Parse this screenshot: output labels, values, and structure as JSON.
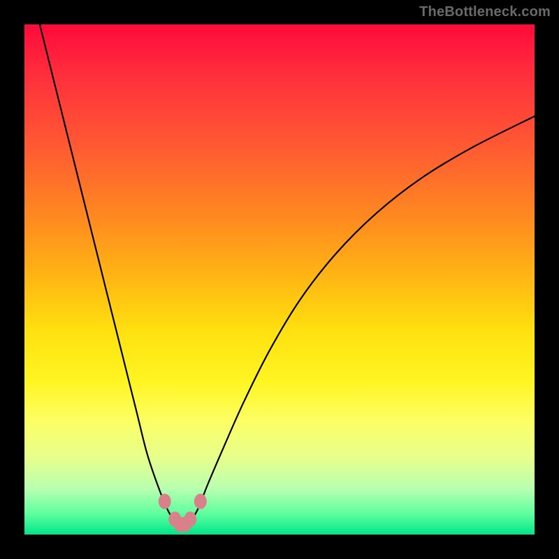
{
  "watermark": "TheBottleneck.com",
  "colors": {
    "frame": "#000000",
    "watermark_text": "#6a6a6a",
    "curve": "#000000",
    "marker": "#d9818a",
    "gradient_top": "#ff0a3a",
    "gradient_bottom": "#00e58a"
  },
  "chart_data": {
    "type": "line",
    "title": "",
    "xlabel": "",
    "ylabel": "",
    "xlim": [
      0,
      100
    ],
    "ylim": [
      0,
      100
    ],
    "grid": false,
    "legend": false,
    "x": [
      3,
      5,
      7,
      10,
      13,
      16,
      19,
      22,
      24,
      26,
      28,
      29.5,
      30.5,
      31.5,
      32.5,
      34,
      36,
      39,
      43,
      48,
      54,
      61,
      69,
      78,
      88,
      100
    ],
    "y": [
      100,
      92,
      84,
      72,
      60,
      48,
      36,
      24,
      16,
      10,
      5,
      2.5,
      1.5,
      1.5,
      2.5,
      5,
      10,
      17,
      26,
      36,
      46,
      55,
      63,
      70,
      76,
      82
    ],
    "markers": {
      "x": [
        27.5,
        29.5,
        30.5,
        31.5,
        32.5,
        34.5
      ],
      "y": [
        6.5,
        3,
        2,
        2,
        3,
        6.5
      ]
    },
    "notes": "V-shaped curve with minimum near x≈31; values estimated from unlabeled axes as percentages of plot area."
  }
}
